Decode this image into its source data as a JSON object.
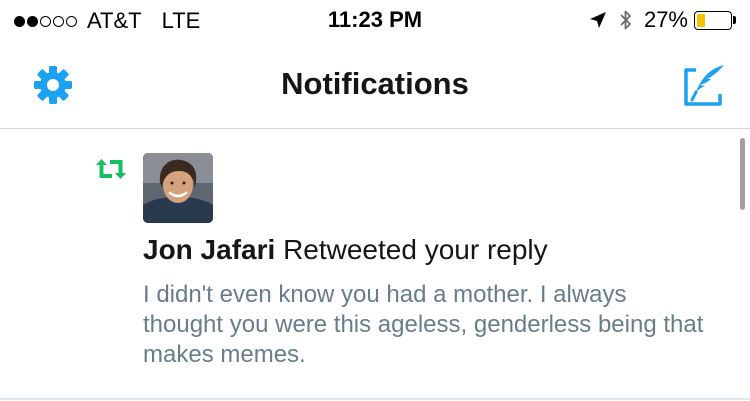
{
  "status_bar": {
    "signal_filled": 2,
    "signal_total": 5,
    "carrier": "AT&T",
    "network": "LTE",
    "time": "11:23 PM",
    "battery_percent": "27%",
    "battery_level": 0.27,
    "battery_color": "#f5c400"
  },
  "nav": {
    "title": "Notifications",
    "settings_icon": "gear-icon",
    "compose_icon": "compose-tweet-icon",
    "accent_color": "#1da1f2"
  },
  "notification": {
    "type_icon": "retweet-icon",
    "type_color": "#17bf63",
    "user_name": "Jon Jafari",
    "action": "Retweeted your reply",
    "tweet_text": "I didn't even know you had a mother. I always thought you were this ageless, genderless being that makes memes."
  }
}
